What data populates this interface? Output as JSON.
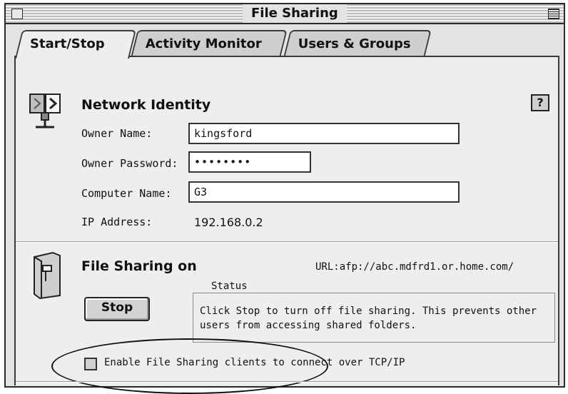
{
  "window": {
    "title": "File Sharing"
  },
  "tabs": [
    {
      "label": "Start/Stop",
      "active": true
    },
    {
      "label": "Activity Monitor",
      "active": false
    },
    {
      "label": "Users & Groups",
      "active": false
    }
  ],
  "network_identity": {
    "heading": "Network Identity",
    "owner_name_label": "Owner Name:",
    "owner_name_value": "kingsford",
    "owner_password_label": "Owner Password:",
    "owner_password_value": "••••••••",
    "computer_name_label": "Computer Name:",
    "computer_name_value": "G3",
    "ip_address_label": "IP Address:",
    "ip_address_value": "192.168.0.2"
  },
  "help": {
    "label": "?"
  },
  "file_sharing": {
    "heading": "File Sharing on",
    "url": "URL:afp://abc.mdfrd1.or.home.com/",
    "stop_label": "Stop",
    "status_legend": "Status",
    "status_text": "Click Stop to turn off file sharing. This prevents other users from accessing shared folders.",
    "tcp_checkbox_label": "Enable File Sharing clients to connect over TCP/IP",
    "tcp_checked": false
  },
  "colors": {
    "window_bg": "#e3e3e3",
    "panel_bg": "#eeeeee",
    "border": "#2a2a2a"
  }
}
